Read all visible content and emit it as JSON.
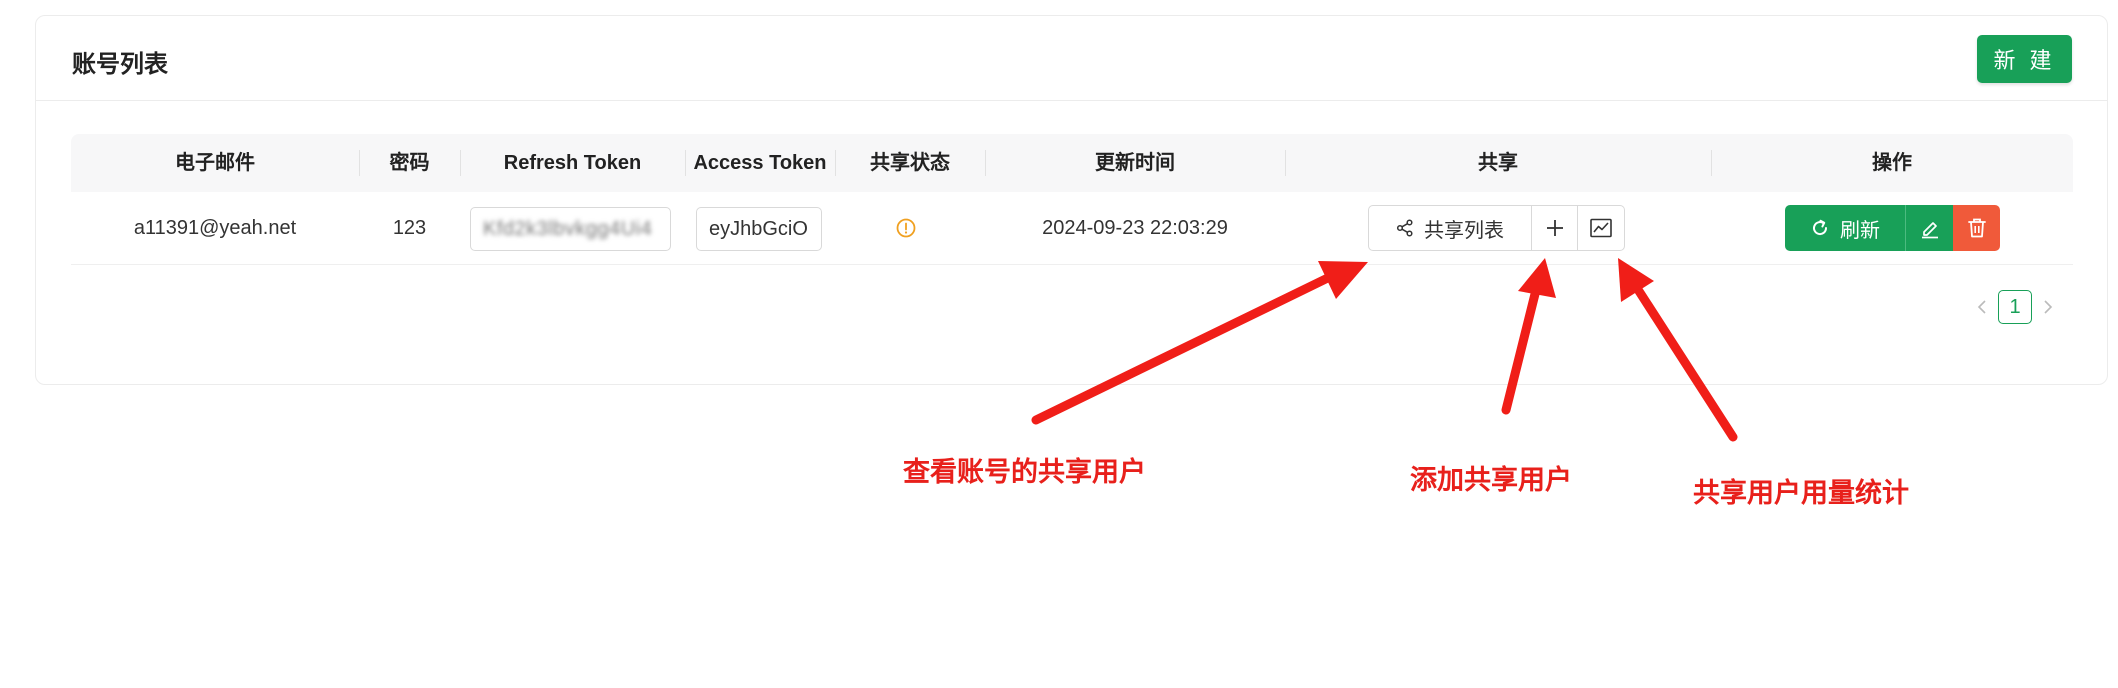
{
  "card": {
    "title": "账号列表",
    "new_button": "新 建"
  },
  "table": {
    "columns": [
      "电子邮件",
      "密码",
      "Refresh Token",
      "Access Token",
      "共享状态",
      "更新时间",
      "共享",
      "操作"
    ],
    "rows": [
      {
        "email": "a11391@yeah.net",
        "password": "123",
        "refresh_token": "Kfd2k3lbvkgg4Ui4",
        "access_token": "eyJhbGciO",
        "share_status_icon": "warning-circle-icon",
        "updated_at": "2024-09-23 22:03:29",
        "share_list_button": "共享列表",
        "refresh_button": "刷新"
      }
    ]
  },
  "pagination": {
    "current_page": "1"
  },
  "annotations": {
    "view_shared": "查看账号的共享用户",
    "add_shared": "添加共享用户",
    "usage_stats": "共享用户用量统计"
  },
  "colors": {
    "primary": "#18a058",
    "danger": "#f05a3a",
    "warning": "#f0a020",
    "annotation": "#e8201b"
  }
}
